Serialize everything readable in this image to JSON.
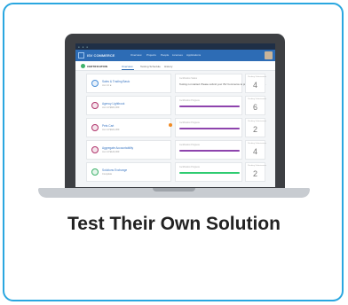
{
  "caption": "Test Their Own Solution",
  "app": {
    "brand": "ISV COMMERCE",
    "nav": [
      "Overview",
      "Projects",
      "People",
      "Licenses",
      "Applications"
    ],
    "subtitle": "CERTIFICATION",
    "tabs": [
      "Overview",
      "Testing Schedule",
      "History"
    ]
  },
  "rows": [
    {
      "name": "Sales & Trading Basic",
      "sub": "Jun 14   ★",
      "mlabel": "Certification Status",
      "mtext": "Testing not started.  Please submit your ISV Commerce to proceed with testing.",
      "progress": null,
      "bar_color": "",
      "rlabel": "Pending Submissions",
      "count": "4",
      "icon_color": "#4a90d9"
    },
    {
      "name": "Agency Lightbook",
      "sub": "Jun 14   $921,000",
      "mlabel": "Certification Progress",
      "mtext": "",
      "progress": 1.0,
      "bar_color": "#8e44ad",
      "rlabel": "Pending Submissions",
      "count": "6",
      "icon_color": "#b0336b"
    },
    {
      "name": "Pets Cart",
      "sub": "Jun 14   $421,000",
      "mlabel": "Certification Progress",
      "mtext": "",
      "progress": 1.0,
      "bar_color": "#8e44ad",
      "rlabel": "Pending Submissions",
      "count": "2",
      "icon_color": "#b0336b"
    },
    {
      "name": "Aggregate Accountability",
      "sub": "Jun 14   $124,000",
      "mlabel": "Certification Progress",
      "mtext": "",
      "progress": 1.0,
      "bar_color": "#8e44ad",
      "rlabel": "Pending Submissions",
      "count": "4",
      "icon_color": "#b0336b"
    },
    {
      "name": "Solutions Exchange",
      "sub": "Complete",
      "mlabel": "Certification Progress",
      "mtext": "",
      "progress": 1.0,
      "bar_color": "#2ecc71",
      "rlabel": "Pending Submissions",
      "count": "2",
      "icon_color": "#3db26b"
    }
  ]
}
